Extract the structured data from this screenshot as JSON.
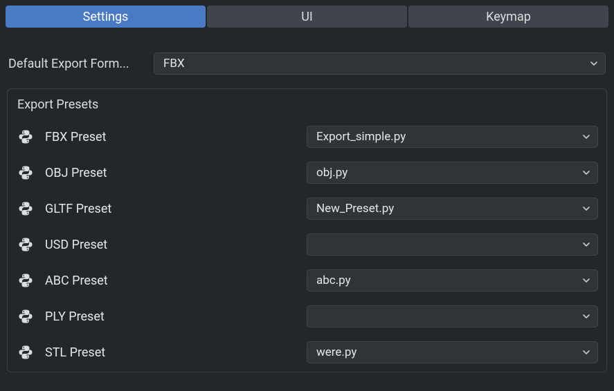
{
  "tabs": [
    {
      "label": "Settings",
      "active": true
    },
    {
      "label": "UI",
      "active": false
    },
    {
      "label": "Keymap",
      "active": false
    }
  ],
  "default_export": {
    "label": "Default Export Form...",
    "value": "FBX"
  },
  "panel": {
    "title": "Export Presets",
    "presets": [
      {
        "label": "FBX Preset",
        "value": "Export_simple.py"
      },
      {
        "label": "OBJ Preset",
        "value": "obj.py"
      },
      {
        "label": "GLTF Preset",
        "value": "New_Preset.py"
      },
      {
        "label": "USD Preset",
        "value": ""
      },
      {
        "label": "ABC Preset",
        "value": "abc.py"
      },
      {
        "label": "PLY Preset",
        "value": ""
      },
      {
        "label": "STL Preset",
        "value": "were.py"
      }
    ]
  },
  "colors": {
    "bg": "#23272b",
    "tab_inactive": "#3f454b",
    "tab_active": "#4a7ac6",
    "field_bg": "#2f3438",
    "border": "#42474c",
    "text": "#d9dde1"
  }
}
